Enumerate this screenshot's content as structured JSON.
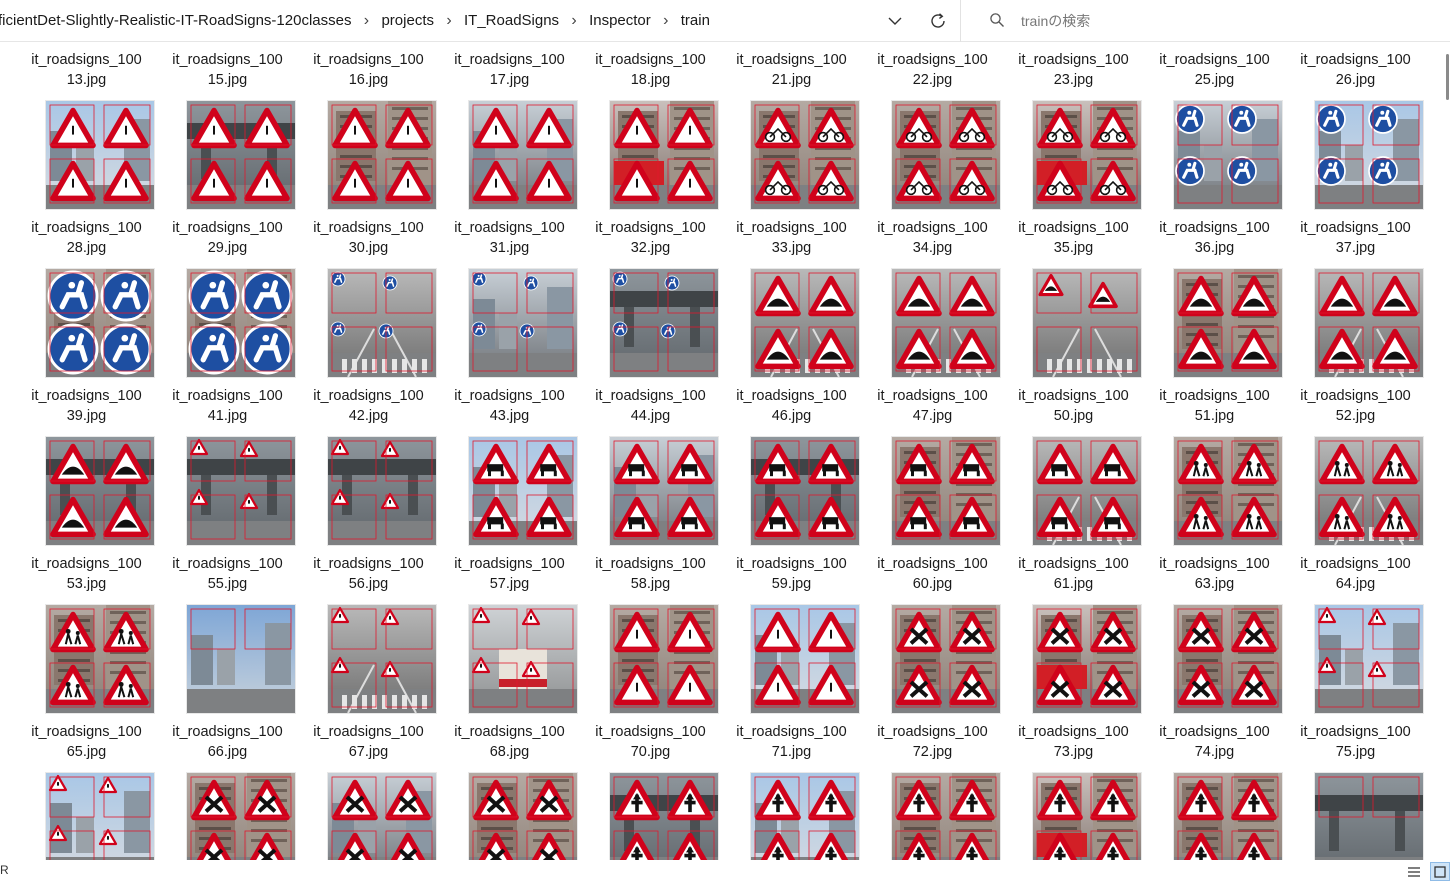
{
  "window": {
    "breadcrumb": [
      "ficientDet-Slightly-Realistic-IT-RoadSigns-120classes",
      "projects",
      "IT_RoadSigns",
      "Inspector",
      "train"
    ],
    "search_placeholder": "trainの検索",
    "accent": "#0067c0"
  },
  "icons": {
    "breadcrumb_separator": "chevron-right-icon",
    "history": "chevron-down-icon",
    "refresh": "refresh-icon",
    "search": "search-icon",
    "view_details": "details-view-icon",
    "view_icons": "large-icons-view-icon"
  },
  "files": [
    {
      "l1": "it_roadsigns_100",
      "l2": "13.jpg",
      "sign": "warn",
      "bg": "street"
    },
    {
      "l1": "it_roadsigns_100",
      "l2": "15.jpg",
      "sign": "warn",
      "bg": "bridge"
    },
    {
      "l1": "it_roadsigns_100",
      "l2": "16.jpg",
      "sign": "warn",
      "bg": "building"
    },
    {
      "l1": "it_roadsigns_100",
      "l2": "17.jpg",
      "sign": "warn",
      "bg": "city"
    },
    {
      "l1": "it_roadsigns_100",
      "l2": "18.jpg",
      "sign": "warn",
      "bg": "red"
    },
    {
      "l1": "it_roadsigns_100",
      "l2": "21.jpg",
      "sign": "bike",
      "bg": "building"
    },
    {
      "l1": "it_roadsigns_100",
      "l2": "22.jpg",
      "sign": "bike",
      "bg": "building"
    },
    {
      "l1": "it_roadsigns_100",
      "l2": "23.jpg",
      "sign": "bike",
      "bg": "red"
    },
    {
      "l1": "it_roadsigns_100",
      "l2": "25.jpg",
      "sign": "horseblue",
      "bg": "city"
    },
    {
      "l1": "it_roadsigns_100",
      "l2": "26.jpg",
      "sign": "horseblue",
      "bg": "street"
    },
    {
      "l1": "it_roadsigns_100",
      "l2": "28.jpg",
      "sign": "horsebig",
      "bg": "building"
    },
    {
      "l1": "it_roadsigns_100",
      "l2": "29.jpg",
      "sign": "horsebig",
      "bg": "building"
    },
    {
      "l1": "it_roadsigns_100",
      "l2": "30.jpg",
      "sign": "horsesmall",
      "bg": "road"
    },
    {
      "l1": "it_roadsigns_100",
      "l2": "31.jpg",
      "sign": "horsesmall",
      "bg": "city"
    },
    {
      "l1": "it_roadsigns_100",
      "l2": "32.jpg",
      "sign": "horsesmall",
      "bg": "bridge"
    },
    {
      "l1": "it_roadsigns_100",
      "l2": "33.jpg",
      "sign": "bump",
      "bg": "road"
    },
    {
      "l1": "it_roadsigns_100",
      "l2": "34.jpg",
      "sign": "bump",
      "bg": "road"
    },
    {
      "l1": "it_roadsigns_100",
      "l2": "35.jpg",
      "sign": "bumpsmall",
      "bg": "road"
    },
    {
      "l1": "it_roadsigns_100",
      "l2": "36.jpg",
      "sign": "bump",
      "bg": "building"
    },
    {
      "l1": "it_roadsigns_100",
      "l2": "37.jpg",
      "sign": "bump",
      "bg": "road"
    },
    {
      "l1": "it_roadsigns_100",
      "l2": "39.jpg",
      "sign": "bump",
      "bg": "bridge"
    },
    {
      "l1": "it_roadsigns_100",
      "l2": "41.jpg",
      "sign": "warnsmall",
      "bg": "bridge"
    },
    {
      "l1": "it_roadsigns_100",
      "l2": "42.jpg",
      "sign": "warnsmall",
      "bg": "bridge"
    },
    {
      "l1": "it_roadsigns_100",
      "l2": "43.jpg",
      "sign": "cow",
      "bg": "street"
    },
    {
      "l1": "it_roadsigns_100",
      "l2": "44.jpg",
      "sign": "cow",
      "bg": "city"
    },
    {
      "l1": "it_roadsigns_100",
      "l2": "46.jpg",
      "sign": "cow",
      "bg": "bridge"
    },
    {
      "l1": "it_roadsigns_100",
      "l2": "47.jpg",
      "sign": "cow",
      "bg": "building"
    },
    {
      "l1": "it_roadsigns_100",
      "l2": "50.jpg",
      "sign": "cow",
      "bg": "road"
    },
    {
      "l1": "it_roadsigns_100",
      "l2": "51.jpg",
      "sign": "kids",
      "bg": "building"
    },
    {
      "l1": "it_roadsigns_100",
      "l2": "52.jpg",
      "sign": "kids",
      "bg": "road"
    },
    {
      "l1": "it_roadsigns_100",
      "l2": "53.jpg",
      "sign": "kids",
      "bg": "building"
    },
    {
      "l1": "it_roadsigns_100",
      "l2": "55.jpg",
      "sign": "none",
      "bg": "tower"
    },
    {
      "l1": "it_roadsigns_100",
      "l2": "56.jpg",
      "sign": "warnsmall",
      "bg": "road"
    },
    {
      "l1": "it_roadsigns_100",
      "l2": "57.jpg",
      "sign": "warnsmall",
      "bg": "bus"
    },
    {
      "l1": "it_roadsigns_100",
      "l2": "58.jpg",
      "sign": "warn",
      "bg": "building"
    },
    {
      "l1": "it_roadsigns_100",
      "l2": "59.jpg",
      "sign": "warn",
      "bg": "street"
    },
    {
      "l1": "it_roadsigns_100",
      "l2": "60.jpg",
      "sign": "cross",
      "bg": "building"
    },
    {
      "l1": "it_roadsigns_100",
      "l2": "61.jpg",
      "sign": "cross",
      "bg": "red"
    },
    {
      "l1": "it_roadsigns_100",
      "l2": "63.jpg",
      "sign": "cross",
      "bg": "building"
    },
    {
      "l1": "it_roadsigns_100",
      "l2": "64.jpg",
      "sign": "warnsmall",
      "bg": "street"
    },
    {
      "l1": "it_roadsigns_100",
      "l2": "65.jpg",
      "sign": "warnsmall",
      "bg": "street"
    },
    {
      "l1": "it_roadsigns_100",
      "l2": "66.jpg",
      "sign": "cross",
      "bg": "building"
    },
    {
      "l1": "it_roadsigns_100",
      "l2": "67.jpg",
      "sign": "cross",
      "bg": "city"
    },
    {
      "l1": "it_roadsigns_100",
      "l2": "68.jpg",
      "sign": "cross",
      "bg": "building"
    },
    {
      "l1": "it_roadsigns_100",
      "l2": "70.jpg",
      "sign": "plus",
      "bg": "bridge"
    },
    {
      "l1": "it_roadsigns_100",
      "l2": "71.jpg",
      "sign": "plus",
      "bg": "street"
    },
    {
      "l1": "it_roadsigns_100",
      "l2": "72.jpg",
      "sign": "plus",
      "bg": "building"
    },
    {
      "l1": "it_roadsigns_100",
      "l2": "73.jpg",
      "sign": "plus",
      "bg": "red"
    },
    {
      "l1": "it_roadsigns_100",
      "l2": "74.jpg",
      "sign": "plus",
      "bg": "building"
    },
    {
      "l1": "it_roadsigns_100",
      "l2": "75.jpg",
      "sign": "none",
      "bg": "bridge"
    }
  ],
  "status": {
    "left_text": "R"
  }
}
